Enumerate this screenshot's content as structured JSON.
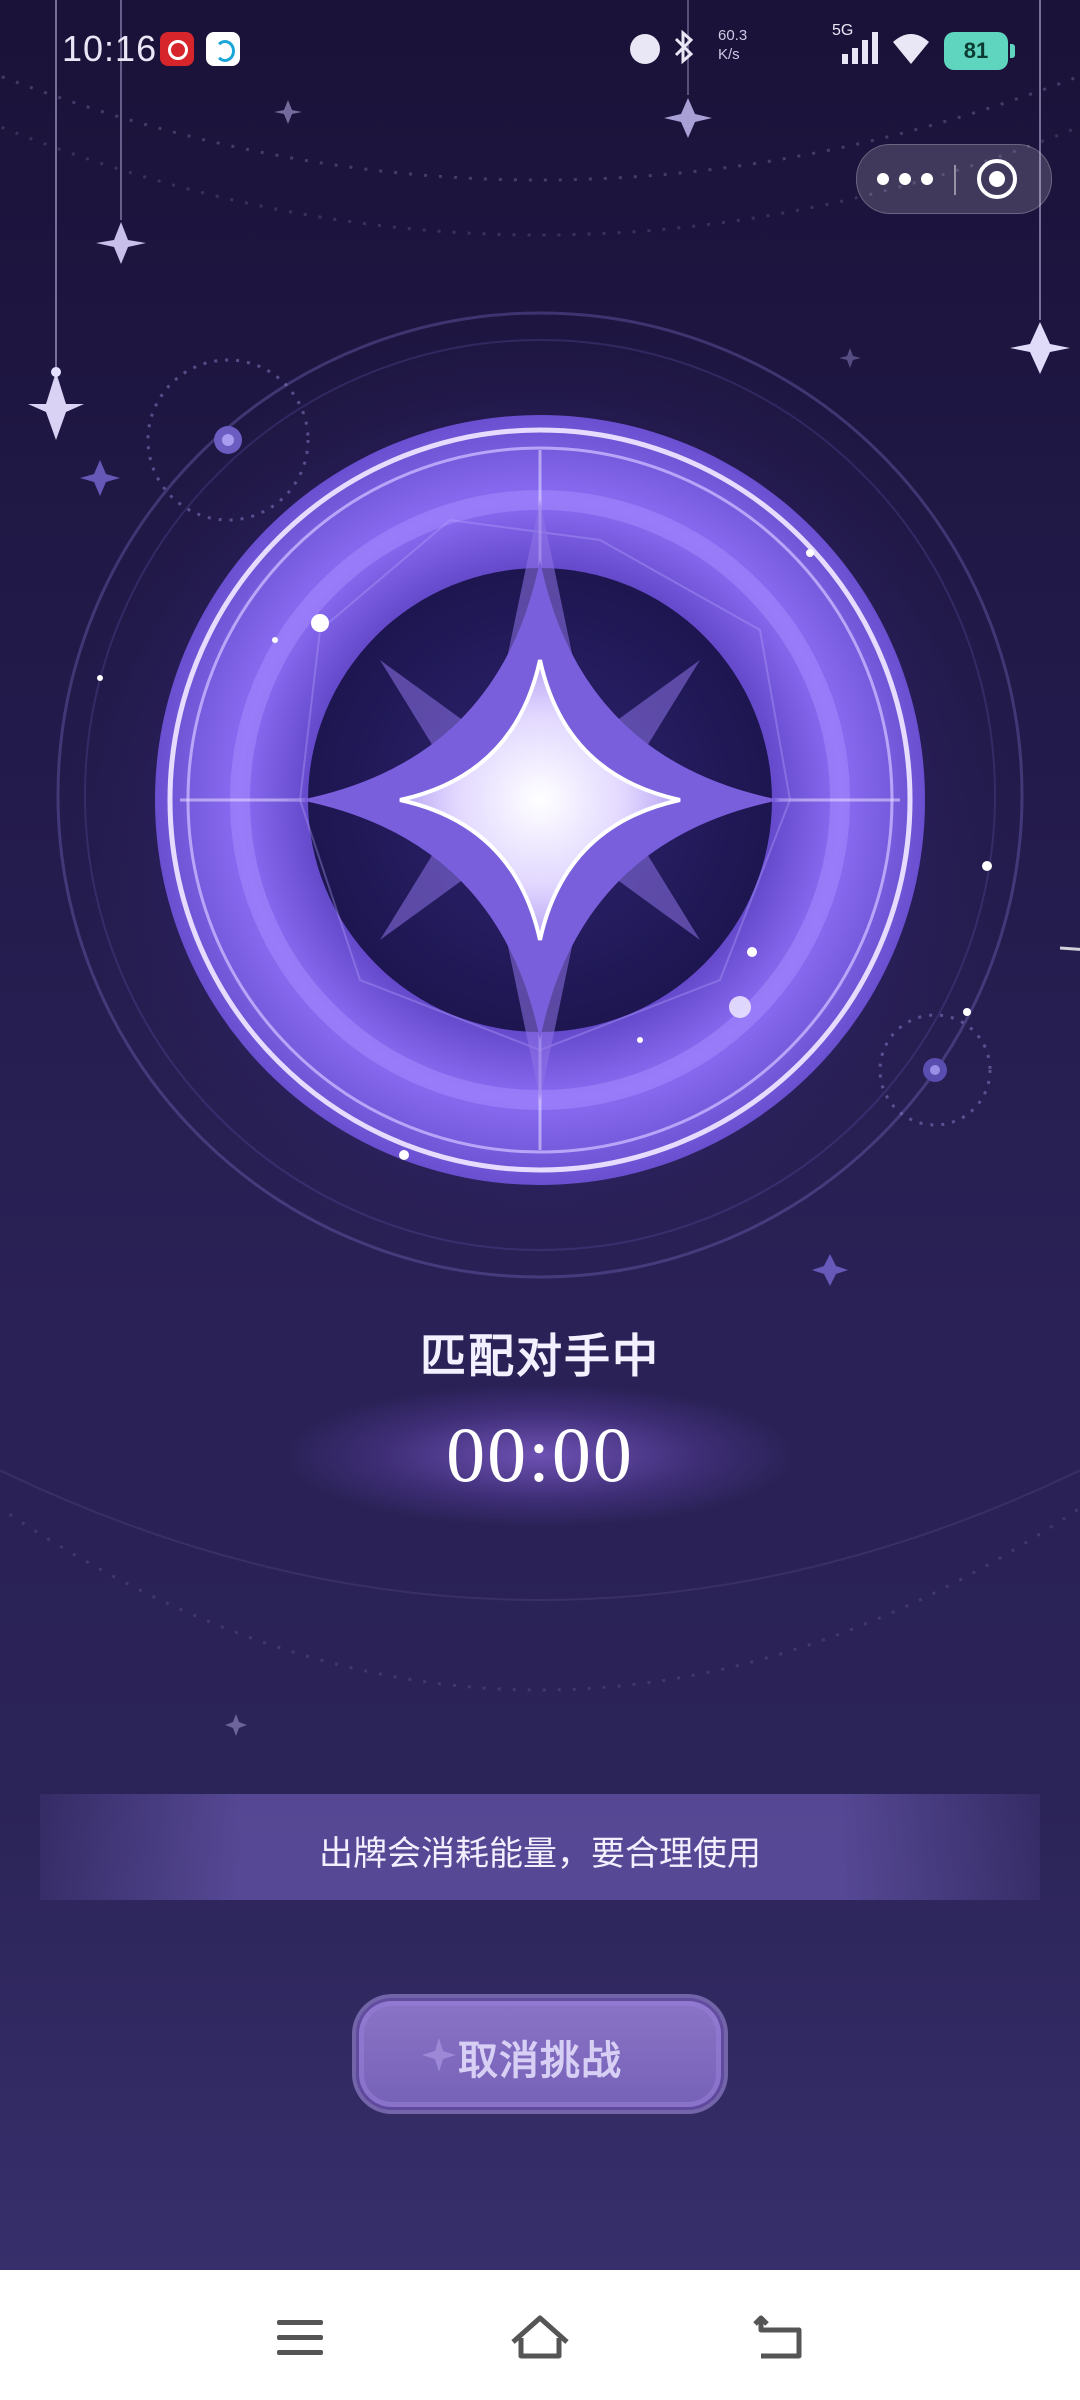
{
  "status_bar": {
    "time": "10:16",
    "net_speed_value": "60.3",
    "net_speed_unit": "K/s",
    "network_type": "5G",
    "battery": "81"
  },
  "capsule": {
    "more_icon": "more-dots-icon",
    "close_icon": "target-close-icon"
  },
  "match": {
    "title": "匹配对手中",
    "timer": "00:00"
  },
  "tip": {
    "text": "出牌会消耗能量，要合理使用"
  },
  "actions": {
    "cancel_label": "取消挑战"
  },
  "nav": {
    "menu_icon": "menu-icon",
    "home_icon": "home-icon",
    "back_icon": "back-icon"
  },
  "colors": {
    "background_top": "#1a1238",
    "background_bottom": "#3a3270",
    "accent_purple": "#8c6cf0",
    "battery": "#5fd4bf"
  }
}
